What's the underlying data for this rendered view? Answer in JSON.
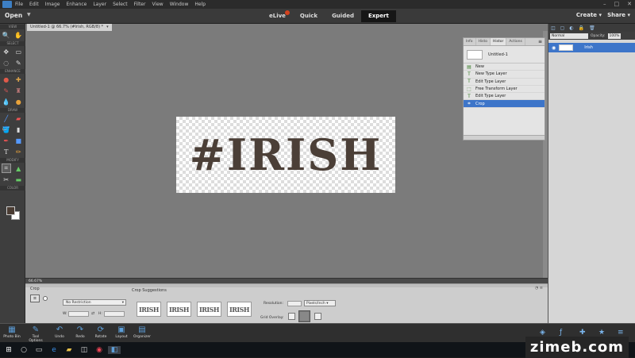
{
  "menubar": {
    "items": [
      "File",
      "Edit",
      "Image",
      "Enhance",
      "Layer",
      "Select",
      "Filter",
      "View",
      "Window",
      "Help"
    ]
  },
  "modebar": {
    "open": "Open",
    "modes": [
      "eLive",
      "Quick",
      "Guided",
      "Expert"
    ],
    "active_mode": "Expert",
    "create": "Create",
    "share": "Share"
  },
  "toolbox": {
    "sections": [
      "VIEW",
      "SELECT",
      "ENHANCE",
      "DRAW",
      "MODIFY",
      "COLOR"
    ]
  },
  "document": {
    "tab_title": "Untitled-1 @ 66.7% (#Irish, RGB/8) *",
    "canvas_text": "#IRISH",
    "zoom": "66.67%"
  },
  "history_panel": {
    "tabs": [
      "Info",
      "Histo",
      "Histor",
      "Actions"
    ],
    "active_tab": "Histor",
    "document_name": "Untitled-1",
    "items": [
      "New",
      "New Type Layer",
      "Edit Type Layer",
      "Free Transform Layer",
      "Edit Type Layer",
      "Crop"
    ],
    "active_item_index": 5
  },
  "layers_panel": {
    "blend_mode": "Normal",
    "opacity_label": "Opacity:",
    "opacity_value": "100%",
    "layer_name": "Irish"
  },
  "tool_options": {
    "crop_label": "Crop",
    "ratio": "No Restriction",
    "w_label": "W:",
    "h_label": "H:",
    "suggestions_label": "Crop Suggestions",
    "suggestions": [
      "IRISH",
      "IRISH",
      "IRISH",
      "IRISH"
    ],
    "resolution_label": "Resolution:",
    "resolution_unit": "Pixels/Inch",
    "grid_overlay_label": "Grid Overlay:"
  },
  "bottom_bar": {
    "buttons": [
      "Photo Bin",
      "Tool Options",
      "Undo",
      "Redo",
      "Rotate",
      "Layout",
      "Organizer"
    ]
  },
  "watermark": "zimeb.com",
  "colors": {
    "canvas_text": "#4b3f37",
    "accent": "#3d75c9",
    "foreground_swatch": "#4a3c33"
  }
}
